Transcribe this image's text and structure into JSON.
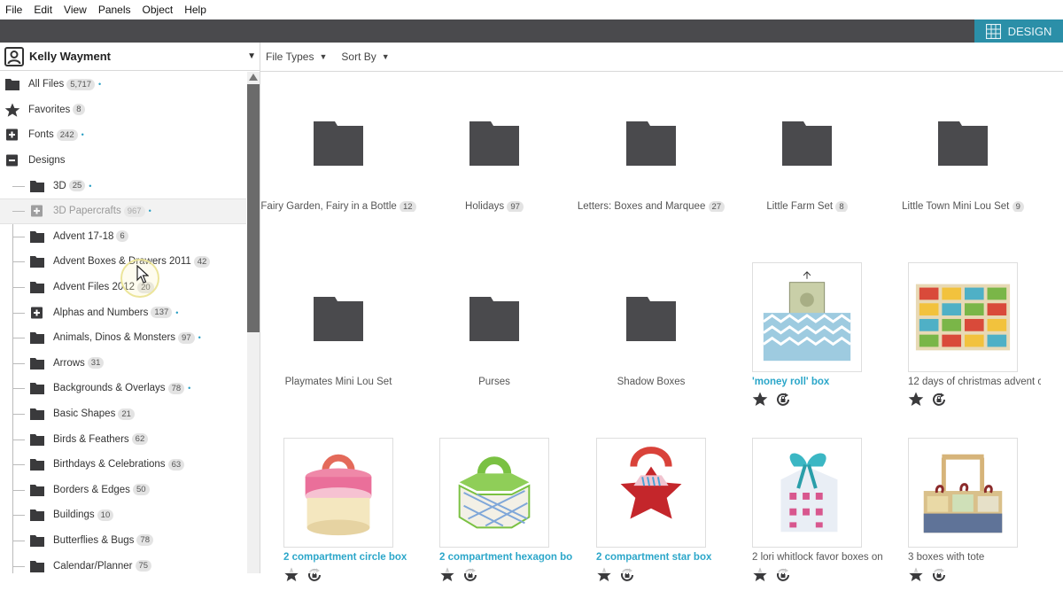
{
  "menu": [
    "File",
    "Edit",
    "View",
    "Panels",
    "Object",
    "Help"
  ],
  "design_button": "DESIGN",
  "user": {
    "name": "Kelly Wayment"
  },
  "toolbar": {
    "file_types": "File Types",
    "sort_by": "Sort By"
  },
  "colors": {
    "accent": "#2b8fa8",
    "link": "#2aa6c9",
    "topbar": "#4a4a4d",
    "folder": "#4a4a4d"
  },
  "tree": [
    {
      "label": "All Files",
      "count": "5,717",
      "dot": true,
      "icon": "folder-icon",
      "level": "top"
    },
    {
      "label": "Favorites",
      "count": "8",
      "dot": false,
      "icon": "star-icon",
      "level": "top"
    },
    {
      "label": "Fonts",
      "count": "242",
      "dot": true,
      "icon": "expand-plus-icon",
      "level": "top"
    },
    {
      "label": "Designs",
      "count": "",
      "dot": false,
      "icon": "collapse-minus-icon",
      "level": "top"
    },
    {
      "label": "3D",
      "count": "25",
      "dot": true,
      "icon": "folder-icon",
      "level": "child"
    },
    {
      "label": "3D Papercrafts",
      "count": "967",
      "dot": true,
      "icon": "expand-plus-icon",
      "level": "child",
      "selected": true
    },
    {
      "label": "Advent 17-18",
      "count": "6",
      "dot": false,
      "icon": "folder-icon",
      "level": "child"
    },
    {
      "label": "Advent Boxes & Drawers 2011",
      "count": "42",
      "dot": false,
      "icon": "folder-icon",
      "level": "child"
    },
    {
      "label": "Advent Files 2012",
      "count": "20",
      "dot": false,
      "icon": "folder-icon",
      "level": "child"
    },
    {
      "label": "Alphas and Numbers",
      "count": "137",
      "dot": true,
      "icon": "expand-plus-icon",
      "level": "child"
    },
    {
      "label": "Animals, Dinos & Monsters",
      "count": "97",
      "dot": true,
      "icon": "folder-icon",
      "level": "child"
    },
    {
      "label": "Arrows",
      "count": "31",
      "dot": false,
      "icon": "folder-icon",
      "level": "child"
    },
    {
      "label": "Backgrounds & Overlays",
      "count": "78",
      "dot": true,
      "icon": "folder-icon",
      "level": "child"
    },
    {
      "label": "Basic Shapes",
      "count": "21",
      "dot": false,
      "icon": "folder-icon",
      "level": "child"
    },
    {
      "label": "Birds & Feathers",
      "count": "62",
      "dot": false,
      "icon": "folder-icon",
      "level": "child"
    },
    {
      "label": "Birthdays & Celebrations",
      "count": "63",
      "dot": false,
      "icon": "folder-icon",
      "level": "child"
    },
    {
      "label": "Borders & Edges",
      "count": "50",
      "dot": false,
      "icon": "folder-icon",
      "level": "child"
    },
    {
      "label": "Buildings",
      "count": "10",
      "dot": false,
      "icon": "folder-icon",
      "level": "child"
    },
    {
      "label": "Butterflies & Bugs",
      "count": "78",
      "dot": false,
      "icon": "folder-icon",
      "level": "child"
    },
    {
      "label": "Calendar/Planner",
      "count": "75",
      "dot": false,
      "icon": "folder-icon",
      "level": "child"
    }
  ],
  "folders": [
    {
      "label": "Fairy Garden, Fairy in a Bottle",
      "count": "12"
    },
    {
      "label": "Holidays",
      "count": "97"
    },
    {
      "label": "Letters: Boxes and Marquee",
      "count": "27"
    },
    {
      "label": "Little Farm Set",
      "count": "8"
    },
    {
      "label": "Little Town Mini Lou Set",
      "count": "9"
    },
    {
      "label": "Playmates Mini Lou Set",
      "count": ""
    },
    {
      "label": "Purses",
      "count": ""
    },
    {
      "label": "Shadow Boxes",
      "count": ""
    }
  ],
  "designs": [
    {
      "label": "'money roll' box",
      "link": true,
      "image": "money-roll-box-image"
    },
    {
      "label": "12 days of christmas advent c",
      "link": false,
      "image": "advent-drawers-image"
    },
    {
      "label": "2 compartment circle box",
      "link": true,
      "image": "circle-box-image"
    },
    {
      "label": "2 compartment hexagon bo",
      "link": true,
      "image": "hexagon-box-image"
    },
    {
      "label": "2 compartment star box",
      "link": true,
      "image": "star-box-image"
    },
    {
      "label": "2 lori whitlock favor boxes on",
      "link": false,
      "image": "favor-boxes-image"
    },
    {
      "label": "3 boxes with tote",
      "link": false,
      "image": "tote-image"
    }
  ]
}
